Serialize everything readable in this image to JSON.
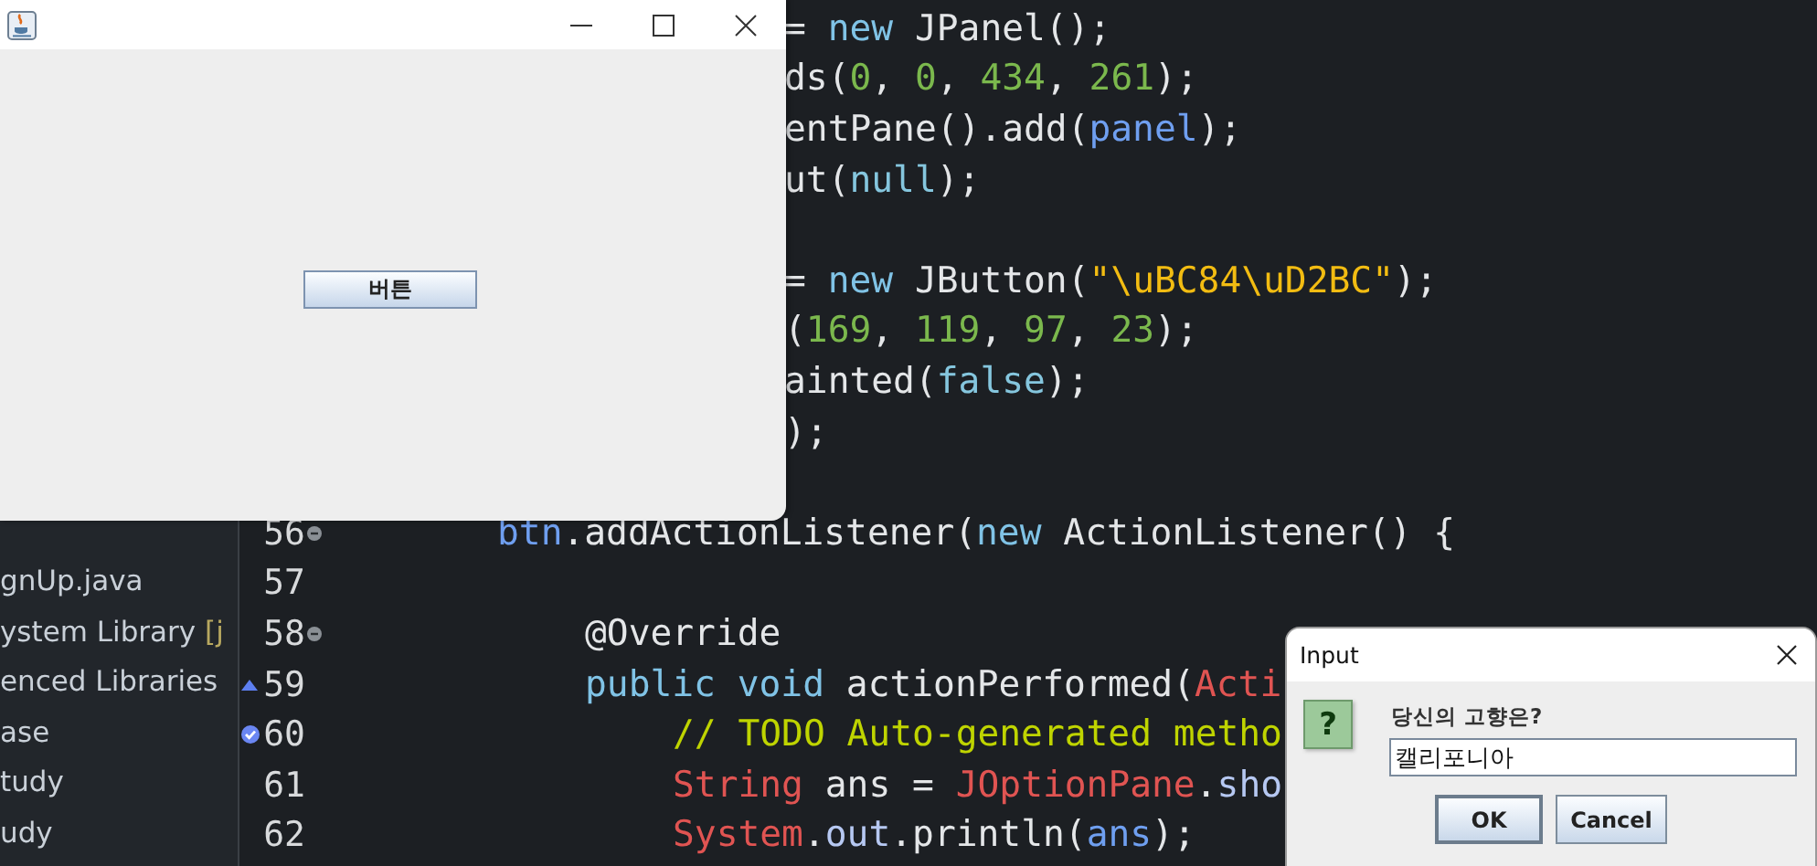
{
  "explorer": {
    "items": [
      {
        "text": "gnUp.java"
      },
      {
        "text": "ystem Library",
        "tag": "[j"
      },
      {
        "text": "enced Libraries"
      },
      {
        "text": "ase"
      },
      {
        "text": "tudy"
      },
      {
        "text": "udy"
      }
    ]
  },
  "editor": {
    "lines": [
      {
        "kind": "covered",
        "tokens": [
          {
            "text": "= ",
            "kind": "plain"
          },
          {
            "text": "new",
            "kind": "keyword"
          },
          {
            "text": " JPanel();",
            "kind": "plain"
          }
        ]
      },
      {
        "kind": "covered",
        "tokens": [
          {
            "text": "ds(",
            "kind": "plain"
          },
          {
            "text": "0",
            "kind": "number"
          },
          {
            "text": ", ",
            "kind": "plain"
          },
          {
            "text": "0",
            "kind": "number"
          },
          {
            "text": ", ",
            "kind": "plain"
          },
          {
            "text": "434",
            "kind": "number"
          },
          {
            "text": ", ",
            "kind": "plain"
          },
          {
            "text": "261",
            "kind": "number"
          },
          {
            "text": ");",
            "kind": "plain"
          }
        ]
      },
      {
        "kind": "covered",
        "tokens": [
          {
            "text": "entPane().add(",
            "kind": "plain"
          },
          {
            "text": "panel",
            "kind": "field"
          },
          {
            "text": ");",
            "kind": "plain"
          }
        ]
      },
      {
        "kind": "covered",
        "tokens": [
          {
            "text": "ut(",
            "kind": "plain"
          },
          {
            "text": "null",
            "kind": "constant"
          },
          {
            "text": ");",
            "kind": "plain"
          }
        ]
      },
      {
        "kind": "covered"
      },
      {
        "kind": "covered",
        "tokens": [
          {
            "text": "= ",
            "kind": "plain"
          },
          {
            "text": "new",
            "kind": "keyword"
          },
          {
            "text": " JButton(",
            "kind": "plain"
          },
          {
            "text": "\"\\uBC84\\uD2BC\"",
            "kind": "string"
          },
          {
            "text": ");",
            "kind": "plain"
          }
        ]
      },
      {
        "kind": "covered",
        "tokens": [
          {
            "text": "(",
            "kind": "plain"
          },
          {
            "text": "169",
            "kind": "number"
          },
          {
            "text": ", ",
            "kind": "plain"
          },
          {
            "text": "119",
            "kind": "number"
          },
          {
            "text": ", ",
            "kind": "plain"
          },
          {
            "text": "97",
            "kind": "number"
          },
          {
            "text": ", ",
            "kind": "plain"
          },
          {
            "text": "23",
            "kind": "number"
          },
          {
            "text": ");",
            "kind": "plain"
          }
        ]
      },
      {
        "kind": "covered",
        "tokens": [
          {
            "text": "ainted(",
            "kind": "plain"
          },
          {
            "text": "false",
            "kind": "constant"
          },
          {
            "text": ");",
            "kind": "plain"
          }
        ]
      },
      {
        "kind": "covered",
        "tokens": [
          {
            "text": ");",
            "kind": "plain"
          }
        ]
      },
      {
        "kind": "covered"
      },
      {
        "kind": "statement",
        "number": "56",
        "foldable": true,
        "override": false,
        "task": false,
        "tokens": [
          {
            "text": "btn",
            "kind": "field"
          },
          {
            "text": ".addActionListener(",
            "kind": "plain"
          },
          {
            "text": "new",
            "kind": "keyword"
          },
          {
            "text": " ActionListener() {",
            "kind": "plain"
          }
        ]
      },
      {
        "kind": "blank",
        "number": "57",
        "foldable": false,
        "override": false,
        "task": false
      },
      {
        "kind": "member",
        "number": "58",
        "foldable": true,
        "override": false,
        "task": false,
        "tokens": [
          {
            "text": "@Override",
            "kind": "plain"
          }
        ]
      },
      {
        "kind": "member",
        "number": "59",
        "foldable": false,
        "override": true,
        "task": false,
        "tokens": [
          {
            "text": "public void",
            "kind": "keyword"
          },
          {
            "text": " actionPerformed(",
            "kind": "plain"
          },
          {
            "text": "Acti",
            "kind": "class"
          }
        ]
      },
      {
        "kind": "body",
        "number": "60",
        "foldable": false,
        "override": false,
        "task": true,
        "tokens": [
          {
            "text": "// TODO Auto-generated metho",
            "kind": "comment"
          }
        ]
      },
      {
        "kind": "body",
        "number": "61",
        "foldable": false,
        "override": false,
        "task": false,
        "tokens": [
          {
            "text": "String",
            "kind": "class"
          },
          {
            "text": " ans = ",
            "kind": "plain"
          },
          {
            "text": "JOptionPane",
            "kind": "class"
          },
          {
            "text": ".",
            "kind": "plain"
          },
          {
            "text": "sho",
            "kind": "call"
          }
        ]
      },
      {
        "kind": "body",
        "number": "62",
        "foldable": false,
        "override": false,
        "task": false,
        "tokens": [
          {
            "text": "System",
            "kind": "class"
          },
          {
            "text": ".",
            "kind": "plain"
          },
          {
            "text": "out",
            "kind": "call"
          },
          {
            "text": ".println(",
            "kind": "plain"
          },
          {
            "text": "ans",
            "kind": "field"
          },
          {
            "text": ");",
            "kind": "plain"
          }
        ]
      }
    ]
  },
  "frame": {
    "button": "버튼"
  },
  "dialog": {
    "title": "Input",
    "icon": "?",
    "message": "당신의 고향은?",
    "value": "캘리포니아",
    "buttons": [
      {
        "label": "OK",
        "default": true
      },
      {
        "label": "Cancel",
        "default": false
      }
    ]
  }
}
